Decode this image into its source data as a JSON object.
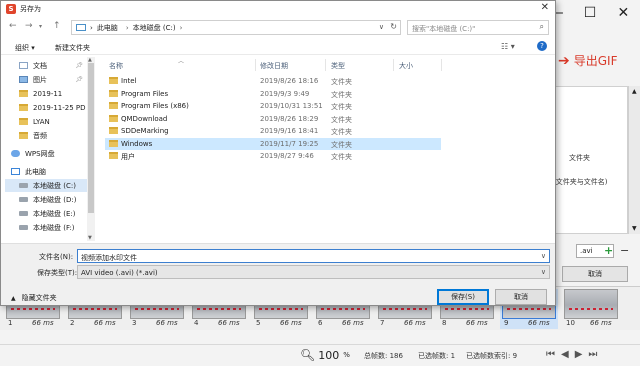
{
  "background": {
    "export_label": "导出GIF",
    "panel_text_1": "文件夹",
    "panel_text_2": "(文件夹与文件名)",
    "ext_value": ".avi",
    "cancel_label": "取消",
    "film_frames": [
      {
        "num": "1",
        "ms": "66 ms"
      },
      {
        "num": "2",
        "ms": "66 ms"
      },
      {
        "num": "3",
        "ms": "66 ms"
      },
      {
        "num": "4",
        "ms": "66 ms"
      },
      {
        "num": "5",
        "ms": "66 ms"
      },
      {
        "num": "6",
        "ms": "66 ms"
      },
      {
        "num": "7",
        "ms": "66 ms"
      },
      {
        "num": "8",
        "ms": "66 ms"
      },
      {
        "num": "9",
        "ms": "66 ms"
      },
      {
        "num": "10",
        "ms": "66 ms"
      }
    ],
    "status": {
      "zoom": "100",
      "zoom_unit": "%",
      "total_frames": "总帧数: 186",
      "selected_frames": "已选帧数: 1",
      "selected_index": "已选帧数索引: 9"
    }
  },
  "dialog": {
    "title": "另存为",
    "app_icon_glyph": "S",
    "address": {
      "root": "此电脑",
      "current": "本地磁盘 (C:)"
    },
    "search_placeholder": "搜索\"本地磁盘 (C:)\"",
    "toolbar": {
      "organize": "组织 ▾",
      "new_folder": "新建文件夹"
    },
    "nav_items": [
      {
        "label": "文档",
        "icon": "document-icon",
        "pinned": true
      },
      {
        "label": "图片",
        "icon": "picture-icon",
        "pinned": true
      },
      {
        "label": "2019-11",
        "icon": "folder-icon",
        "pinned": false
      },
      {
        "label": "2019-11-25 PD",
        "icon": "folder-icon",
        "pinned": false
      },
      {
        "label": "LYAN",
        "icon": "folder-icon",
        "pinned": false
      },
      {
        "label": "音频",
        "icon": "folder-icon",
        "pinned": false
      },
      {
        "label": "WPS网盘",
        "icon": "cloud-icon",
        "pinned": false
      },
      {
        "label": "此电脑",
        "icon": "computer-icon",
        "pinned": false
      },
      {
        "label": "本地磁盘 (C:)",
        "icon": "drive-icon",
        "pinned": false
      },
      {
        "label": "本地磁盘 (D:)",
        "icon": "drive-icon",
        "pinned": false
      },
      {
        "label": "本地磁盘 (E:)",
        "icon": "drive-icon",
        "pinned": false
      },
      {
        "label": "本地磁盘 (F:)",
        "icon": "drive-icon",
        "pinned": false
      }
    ],
    "columns": {
      "name": "名称",
      "date": "修改日期",
      "type": "类型",
      "size": "大小"
    },
    "files": [
      {
        "name": "Intel",
        "date": "2019/8/26 18:16",
        "type": "文件夹"
      },
      {
        "name": "Program Files",
        "date": "2019/9/3 9:49",
        "type": "文件夹"
      },
      {
        "name": "Program Files (x86)",
        "date": "2019/10/31 13:51",
        "type": "文件夹"
      },
      {
        "name": "QMDownload",
        "date": "2019/8/26 18:29",
        "type": "文件夹"
      },
      {
        "name": "SDDeMarking",
        "date": "2019/9/16 18:41",
        "type": "文件夹"
      },
      {
        "name": "Windows",
        "date": "2019/11/7 19:25",
        "type": "文件夹"
      },
      {
        "name": "用户",
        "date": "2019/8/27 9:46",
        "type": "文件夹"
      }
    ],
    "filename_label": "文件名(N):",
    "filename_value": "视频添加水印文件",
    "filetype_label": "保存类型(T):",
    "filetype_value": "AVI video (.avi) (*.avi)",
    "hide_folders": "隐藏文件夹",
    "save_label": "保存(S)",
    "cancel_label": "取消"
  }
}
